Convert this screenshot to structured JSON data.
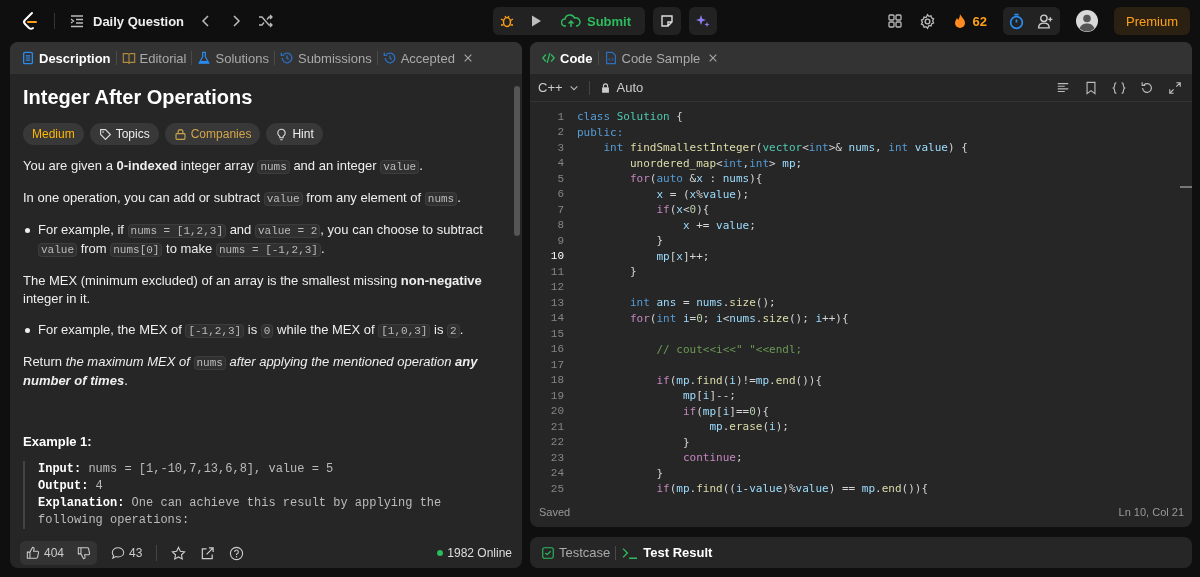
{
  "topbar": {
    "title": "Daily Question",
    "submit": "Submit",
    "streak": "62",
    "premium": "Premium"
  },
  "problem_tabs": [
    {
      "label": "Description",
      "kind": "description",
      "selected": true,
      "closable": false
    },
    {
      "label": "Editorial",
      "kind": "editorial",
      "selected": false,
      "closable": false
    },
    {
      "label": "Solutions",
      "kind": "solutions",
      "selected": false,
      "closable": false
    },
    {
      "label": "Submissions",
      "kind": "submissions",
      "selected": false,
      "closable": false
    },
    {
      "label": "Accepted",
      "kind": "submissions",
      "selected": false,
      "closable": true
    }
  ],
  "problem": {
    "title": "Integer After Operations",
    "tags": [
      {
        "label": "Medium",
        "kind": "difficulty"
      },
      {
        "label": "Topics",
        "kind": "topics"
      },
      {
        "label": "Companies",
        "kind": "companies"
      },
      {
        "label": "Hint",
        "kind": "hint"
      }
    ],
    "blocks": [
      {
        "kind": "paragraph",
        "segments": [
          {
            "kind": "text",
            "text": "You are given a **0-indexed** integer array "
          },
          {
            "kind": "code",
            "text": "nums"
          },
          {
            "kind": "text",
            "text": " and an integer "
          },
          {
            "kind": "code",
            "text": "value"
          },
          {
            "kind": "text",
            "text": "."
          }
        ]
      },
      {
        "kind": "paragraph",
        "segments": [
          {
            "kind": "text",
            "text": "In one operation, you can add or subtract "
          },
          {
            "kind": "code",
            "text": "value"
          },
          {
            "kind": "text",
            "text": " from any element of "
          },
          {
            "kind": "code",
            "text": "nums"
          },
          {
            "kind": "text",
            "text": "."
          }
        ]
      },
      {
        "kind": "bullet",
        "segments": [
          {
            "kind": "text",
            "text": "For example, if "
          },
          {
            "kind": "code",
            "text": "nums = [1,2,3]"
          },
          {
            "kind": "text",
            "text": " and "
          },
          {
            "kind": "code",
            "text": "value = 2"
          },
          {
            "kind": "text",
            "text": ", you can choose to subtract "
          },
          {
            "kind": "code",
            "text": "value"
          },
          {
            "kind": "text",
            "text": " from "
          },
          {
            "kind": "code",
            "text": "nums[0]"
          },
          {
            "kind": "text",
            "text": " to make "
          },
          {
            "kind": "code",
            "text": "nums = [-1,2,3]"
          },
          {
            "kind": "text",
            "text": "."
          }
        ]
      },
      {
        "kind": "paragraph",
        "segments": [
          {
            "kind": "text",
            "text": "The MEX (minimum excluded) of an array is the smallest missing **non-negative** integer in it."
          }
        ]
      },
      {
        "kind": "bullet",
        "segments": [
          {
            "kind": "text",
            "text": "For example, the MEX of "
          },
          {
            "kind": "code",
            "text": "[-1,2,3]"
          },
          {
            "kind": "text",
            "text": " is "
          },
          {
            "kind": "code",
            "text": "0"
          },
          {
            "kind": "text",
            "text": " while the MEX of "
          },
          {
            "kind": "code",
            "text": "[1,0,3]"
          },
          {
            "kind": "text",
            "text": " is "
          },
          {
            "kind": "code",
            "text": "2"
          },
          {
            "kind": "text",
            "text": "."
          }
        ]
      },
      {
        "kind": "paragraph",
        "segments": [
          {
            "kind": "text",
            "text": "Return "
          },
          {
            "kind": "emph",
            "text": "the maximum MEX of "
          },
          {
            "kind": "code",
            "text": "nums"
          },
          {
            "kind": "emph",
            "text": " after applying the mentioned operation **any number of times**"
          },
          {
            "kind": "text",
            "text": "."
          }
        ]
      }
    ],
    "example": {
      "title": "Example 1:",
      "lines": [
        {
          "label": "Input:",
          "text": "nums = [1,-10,7,13,6,8], value = 5"
        },
        {
          "label": "Output:",
          "text": "4"
        },
        {
          "label": "Explanation:",
          "text": "One can achieve this result by applying the following operations:"
        }
      ]
    }
  },
  "problem_footer": {
    "likes": "404",
    "comments": "43",
    "online": "1982 Online"
  },
  "editor_tabs": [
    {
      "label": "Code",
      "kind": "code",
      "selected": true,
      "closable": false
    },
    {
      "label": "Code Sample",
      "kind": "file",
      "selected": false,
      "closable": true
    }
  ],
  "editor": {
    "language": "C++",
    "mode": "Auto",
    "status": "Saved",
    "cursor": "Ln 10, Col 21",
    "lines": [
      {
        "number": "1",
        "selected": false,
        "tokens": [
          {
            "kind": "keyword",
            "text": "class"
          },
          {
            "kind": "type",
            "text": " Solution"
          },
          {
            "kind": "plain",
            "text": " {"
          }
        ]
      },
      {
        "number": "2",
        "selected": false,
        "tokens": [
          {
            "kind": "keyword",
            "text": "public:"
          }
        ]
      },
      {
        "number": "3",
        "selected": false,
        "tokens": [
          {
            "kind": "keyword",
            "text": "    int"
          },
          {
            "kind": "function",
            "text": " findSmallestInteger"
          },
          {
            "kind": "plain",
            "text": "("
          },
          {
            "kind": "type",
            "text": "vector"
          },
          {
            "kind": "plain",
            "text": "<"
          },
          {
            "kind": "keyword",
            "text": "int"
          },
          {
            "kind": "plain",
            "text": ">& "
          },
          {
            "kind": "variable",
            "text": "nums"
          },
          {
            "kind": "plain",
            "text": ", "
          },
          {
            "kind": "keyword",
            "text": "int"
          },
          {
            "kind": "variable",
            "text": " value"
          },
          {
            "kind": "plain",
            "text": ") {"
          }
        ]
      },
      {
        "number": "4",
        "selected": false,
        "tokens": [
          {
            "kind": "function",
            "text": "        unordered_map"
          },
          {
            "kind": "plain",
            "text": "<"
          },
          {
            "kind": "keyword",
            "text": "int"
          },
          {
            "kind": "plain",
            "text": ","
          },
          {
            "kind": "keyword",
            "text": "int"
          },
          {
            "kind": "plain",
            "text": "> "
          },
          {
            "kind": "variable",
            "text": "mp"
          },
          {
            "kind": "plain",
            "text": ";"
          }
        ]
      },
      {
        "number": "5",
        "selected": false,
        "tokens": [
          {
            "kind": "control",
            "text": "        for"
          },
          {
            "kind": "plain",
            "text": "("
          },
          {
            "kind": "keyword",
            "text": "auto"
          },
          {
            "kind": "plain",
            "text": " &"
          },
          {
            "kind": "variable",
            "text": "x"
          },
          {
            "kind": "plain",
            "text": " : "
          },
          {
            "kind": "variable",
            "text": "nums"
          },
          {
            "kind": "plain",
            "text": "){"
          }
        ]
      },
      {
        "number": "6",
        "selected": false,
        "tokens": [
          {
            "kind": "variable",
            "text": "            x"
          },
          {
            "kind": "plain",
            "text": " = ("
          },
          {
            "kind": "variable",
            "text": "x"
          },
          {
            "kind": "plain",
            "text": "%"
          },
          {
            "kind": "variable",
            "text": "value"
          },
          {
            "kind": "plain",
            "text": ");"
          }
        ]
      },
      {
        "number": "7",
        "selected": false,
        "tokens": [
          {
            "kind": "control",
            "text": "            if"
          },
          {
            "kind": "plain",
            "text": "("
          },
          {
            "kind": "variable",
            "text": "x"
          },
          {
            "kind": "plain",
            "text": "<"
          },
          {
            "kind": "number",
            "text": "0"
          },
          {
            "kind": "plain",
            "text": "){"
          }
        ]
      },
      {
        "number": "8",
        "selected": false,
        "tokens": [
          {
            "kind": "variable",
            "text": "                x"
          },
          {
            "kind": "plain",
            "text": " += "
          },
          {
            "kind": "variable",
            "text": "value"
          },
          {
            "kind": "plain",
            "text": ";"
          }
        ]
      },
      {
        "number": "9",
        "selected": false,
        "tokens": [
          {
            "kind": "plain",
            "text": "            }"
          }
        ]
      },
      {
        "number": "10",
        "selected": true,
        "tokens": [
          {
            "kind": "variable",
            "text": "            mp"
          },
          {
            "kind": "plain",
            "text": "["
          },
          {
            "kind": "variable",
            "text": "x"
          },
          {
            "kind": "plain",
            "text": "]++;"
          }
        ]
      },
      {
        "number": "11",
        "selected": false,
        "tokens": [
          {
            "kind": "plain",
            "text": "        }"
          }
        ]
      },
      {
        "number": "12",
        "selected": false
      },
      {
        "number": "13",
        "selected": false,
        "tokens": [
          {
            "kind": "keyword",
            "text": "        int"
          },
          {
            "kind": "variable",
            "text": " ans"
          },
          {
            "kind": "plain",
            "text": " = "
          },
          {
            "kind": "variable",
            "text": "nums"
          },
          {
            "kind": "plain",
            "text": "."
          },
          {
            "kind": "function",
            "text": "size"
          },
          {
            "kind": "plain",
            "text": "();"
          }
        ]
      },
      {
        "number": "14",
        "selected": false,
        "tokens": [
          {
            "kind": "control",
            "text": "        for"
          },
          {
            "kind": "plain",
            "text": "("
          },
          {
            "kind": "keyword",
            "text": "int"
          },
          {
            "kind": "variable",
            "text": " i"
          },
          {
            "kind": "plain",
            "text": "="
          },
          {
            "kind": "number",
            "text": "0"
          },
          {
            "kind": "plain",
            "text": "; "
          },
          {
            "kind": "variable",
            "text": "i"
          },
          {
            "kind": "plain",
            "text": "<"
          },
          {
            "kind": "variable",
            "text": "nums"
          },
          {
            "kind": "plain",
            "text": "."
          },
          {
            "kind": "function",
            "text": "size"
          },
          {
            "kind": "plain",
            "text": "(); "
          },
          {
            "kind": "variable",
            "text": "i"
          },
          {
            "kind": "plain",
            "text": "++){"
          }
        ]
      },
      {
        "number": "15",
        "selected": false
      },
      {
        "number": "16",
        "selected": false,
        "tokens": [
          {
            "kind": "comment",
            "text": "            // cout<<i<<\" \"<<endl;"
          }
        ]
      },
      {
        "number": "17",
        "selected": false
      },
      {
        "number": "18",
        "selected": false,
        "tokens": [
          {
            "kind": "control",
            "text": "            if"
          },
          {
            "kind": "plain",
            "text": "("
          },
          {
            "kind": "variable",
            "text": "mp"
          },
          {
            "kind": "plain",
            "text": "."
          },
          {
            "kind": "function",
            "text": "find"
          },
          {
            "kind": "plain",
            "text": "("
          },
          {
            "kind": "variable",
            "text": "i"
          },
          {
            "kind": "plain",
            "text": ")!="
          },
          {
            "kind": "variable",
            "text": "mp"
          },
          {
            "kind": "plain",
            "text": "."
          },
          {
            "kind": "function",
            "text": "end"
          },
          {
            "kind": "plain",
            "text": "()){"
          }
        ]
      },
      {
        "number": "19",
        "selected": false,
        "tokens": [
          {
            "kind": "variable",
            "text": "                mp"
          },
          {
            "kind": "plain",
            "text": "["
          },
          {
            "kind": "variable",
            "text": "i"
          },
          {
            "kind": "plain",
            "text": "]--;"
          }
        ]
      },
      {
        "number": "20",
        "selected": false,
        "tokens": [
          {
            "kind": "control",
            "text": "                if"
          },
          {
            "kind": "plain",
            "text": "("
          },
          {
            "kind": "variable",
            "text": "mp"
          },
          {
            "kind": "plain",
            "text": "["
          },
          {
            "kind": "variable",
            "text": "i"
          },
          {
            "kind": "plain",
            "text": "]=="
          },
          {
            "kind": "number",
            "text": "0"
          },
          {
            "kind": "plain",
            "text": "){"
          }
        ]
      },
      {
        "number": "21",
        "selected": false,
        "tokens": [
          {
            "kind": "variable",
            "text": "                    mp"
          },
          {
            "kind": "plain",
            "text": "."
          },
          {
            "kind": "function",
            "text": "erase"
          },
          {
            "kind": "plain",
            "text": "("
          },
          {
            "kind": "variable",
            "text": "i"
          },
          {
            "kind": "plain",
            "text": ");"
          }
        ]
      },
      {
        "number": "22",
        "selected": false,
        "tokens": [
          {
            "kind": "plain",
            "text": "                }"
          }
        ]
      },
      {
        "number": "23",
        "selected": false,
        "tokens": [
          {
            "kind": "control",
            "text": "                continue"
          },
          {
            "kind": "plain",
            "text": ";"
          }
        ]
      },
      {
        "number": "24",
        "selected": false,
        "tokens": [
          {
            "kind": "plain",
            "text": "            }"
          }
        ]
      },
      {
        "number": "25",
        "selected": false,
        "tokens": [
          {
            "kind": "control",
            "text": "            if"
          },
          {
            "kind": "plain",
            "text": "("
          },
          {
            "kind": "variable",
            "text": "mp"
          },
          {
            "kind": "plain",
            "text": "."
          },
          {
            "kind": "function",
            "text": "find"
          },
          {
            "kind": "plain",
            "text": "(("
          },
          {
            "kind": "variable",
            "text": "i"
          },
          {
            "kind": "plain",
            "text": "-"
          },
          {
            "kind": "variable",
            "text": "value"
          },
          {
            "kind": "plain",
            "text": ")%"
          },
          {
            "kind": "variable",
            "text": "value"
          },
          {
            "kind": "plain",
            "text": ") == "
          },
          {
            "kind": "variable",
            "text": "mp"
          },
          {
            "kind": "plain",
            "text": "."
          },
          {
            "kind": "function",
            "text": "end"
          },
          {
            "kind": "plain",
            "text": "()){"
          }
        ]
      }
    ]
  },
  "console_tabs": [
    {
      "label": "Testcase",
      "kind": "check",
      "selected": false
    },
    {
      "label": "Test Result",
      "kind": "terminal",
      "selected": true
    }
  ]
}
